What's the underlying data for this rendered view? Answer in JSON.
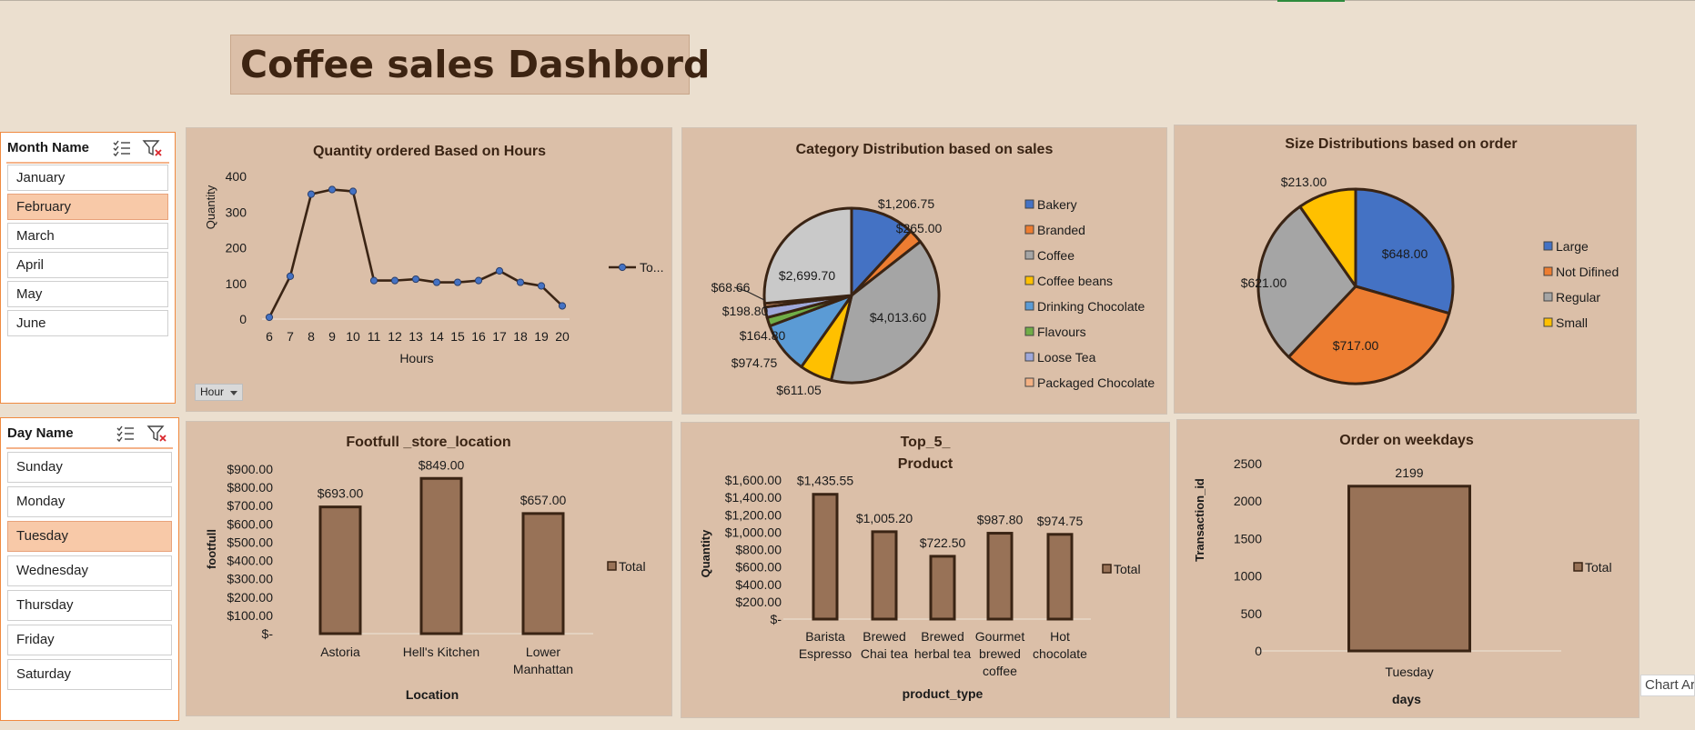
{
  "dashboard": {
    "title": "Coffee sales Dashbord"
  },
  "slicers": {
    "month": {
      "title": "Month Name",
      "items": [
        {
          "label": "January",
          "selected": false
        },
        {
          "label": "February",
          "selected": true
        },
        {
          "label": "March",
          "selected": false
        },
        {
          "label": "April",
          "selected": false
        },
        {
          "label": "May",
          "selected": false
        },
        {
          "label": "June",
          "selected": false
        }
      ]
    },
    "day": {
      "title": "Day Name",
      "items": [
        {
          "label": "Sunday",
          "selected": false
        },
        {
          "label": "Monday",
          "selected": false
        },
        {
          "label": "Tuesday",
          "selected": true
        },
        {
          "label": "Wednesday",
          "selected": false
        },
        {
          "label": "Thursday",
          "selected": false
        },
        {
          "label": "Friday",
          "selected": false
        },
        {
          "label": "Saturday",
          "selected": false
        }
      ]
    }
  },
  "hour_filter": {
    "label": "Hour"
  },
  "tooltip": {
    "text": "Chart Area"
  },
  "colors": {
    "panel": "#dbbfa8",
    "bar": "#987257",
    "dark": "#3a2414",
    "marker": "#4472c4"
  },
  "chart_data": [
    {
      "id": "hours",
      "type": "line",
      "title": "Quantity  ordered Based on Hours",
      "xlabel": "Hours",
      "ylabel": "Quantity",
      "x": [
        6,
        7,
        8,
        9,
        10,
        11,
        12,
        13,
        14,
        15,
        16,
        17,
        18,
        19,
        20
      ],
      "series": [
        {
          "name": "To...",
          "values": [
            5,
            120,
            350,
            363,
            358,
            108,
            108,
            112,
            103,
            103,
            108,
            135,
            103,
            93,
            37
          ]
        }
      ],
      "yticks": [
        "400",
        "300",
        "200",
        "100",
        "0"
      ],
      "ylim": [
        0,
        400
      ],
      "legend": "right"
    },
    {
      "id": "category",
      "type": "pie",
      "title": "Category Distribution based on sales",
      "labels": [
        "Bakery",
        "Branded",
        "Coffee",
        "Coffee beans",
        "Drinking Chocolate",
        "Flavours",
        "Loose Tea",
        "Packaged Chocolate"
      ],
      "data_labels": [
        "$1,206.75",
        "$265.00",
        "$4,013.60",
        "$611.05",
        "$974.75",
        "$164.80",
        "$198.80",
        "$68.66",
        "$2,699.70"
      ],
      "slices": [
        {
          "label": "Bakery",
          "value": 1206.75,
          "color": "#4472c4"
        },
        {
          "label": "Branded",
          "value": 265.0,
          "color": "#ed7d31"
        },
        {
          "label": "Coffee",
          "value": 4013.6,
          "color": "#a5a5a5"
        },
        {
          "label": "Coffee beans",
          "value": 611.05,
          "color": "#ffc000"
        },
        {
          "label": "Drinking Chocolate",
          "value": 974.75,
          "color": "#5b9bd5"
        },
        {
          "label": "Flavours",
          "value": 164.8,
          "color": "#70ad47"
        },
        {
          "label": "Loose Tea",
          "value": 198.8,
          "color": "#9fa8da"
        },
        {
          "label": "Packaged Chocolate",
          "value": 68.66,
          "color": "#f4b183"
        },
        {
          "label": "",
          "value": 2699.7,
          "color": "#c9c9c9"
        }
      ],
      "legend": "right"
    },
    {
      "id": "size",
      "type": "pie",
      "title": "Size Distributions based on order",
      "labels": [
        "Large",
        "Not Difined",
        "Regular",
        "Small"
      ],
      "data_labels": [
        "$648.00",
        "$717.00",
        "$621.00",
        "$213.00"
      ],
      "slices": [
        {
          "label": "Large",
          "value": 648,
          "color": "#4472c4"
        },
        {
          "label": "Not Difined",
          "value": 717,
          "color": "#ed7d31"
        },
        {
          "label": "Regular",
          "value": 621,
          "color": "#a5a5a5"
        },
        {
          "label": "Small",
          "value": 213,
          "color": "#ffc000"
        }
      ],
      "legend": "right"
    },
    {
      "id": "footfall",
      "type": "bar",
      "title": "Footfull _store_location",
      "xlabel": "Location",
      "ylabel": "footfull",
      "categories": [
        "Astoria",
        "Hell's Kitchen",
        "Lower Manhattan"
      ],
      "values": [
        693,
        849,
        657
      ],
      "data_labels": [
        "$693.00",
        "$849.00",
        "$657.00"
      ],
      "yticks": [
        "$900.00",
        "$800.00",
        "$700.00",
        "$600.00",
        "$500.00",
        "$400.00",
        "$300.00",
        "$200.00",
        "$100.00",
        "$-"
      ],
      "ylim": [
        0,
        900
      ],
      "series": [
        {
          "name": "Total"
        }
      ],
      "legend": "right"
    },
    {
      "id": "top5",
      "type": "bar",
      "title": "Top_5_ Product",
      "title_lines": [
        "Top_5_",
        "Product"
      ],
      "xlabel": "product_type",
      "ylabel": "Quantity",
      "categories": [
        "Barista Espresso",
        "Brewed Chai tea",
        "Brewed herbal tea",
        "Gourmet brewed coffee",
        "Hot chocolate"
      ],
      "category_lines": [
        [
          "Barista",
          "Espresso"
        ],
        [
          "Brewed",
          "Chai tea"
        ],
        [
          "Brewed",
          "herbal tea"
        ],
        [
          "Gourmet",
          "brewed",
          "coffee"
        ],
        [
          "Hot",
          "chocolate"
        ]
      ],
      "values": [
        1435.55,
        1005.2,
        722.5,
        987.8,
        974.75
      ],
      "data_labels": [
        "$1,435.55",
        "$1,005.20",
        "$722.50",
        "$987.80",
        "$974.75"
      ],
      "yticks": [
        "$1,600.00",
        "$1,400.00",
        "$1,200.00",
        "$1,000.00",
        "$800.00",
        "$600.00",
        "$400.00",
        "$200.00",
        "$-"
      ],
      "ylim": [
        0,
        1600
      ],
      "series": [
        {
          "name": "Total"
        }
      ],
      "legend": "right"
    },
    {
      "id": "weekdays",
      "type": "bar",
      "title": "Order on weekdays",
      "xlabel": "days",
      "ylabel": "Transaction_id",
      "categories": [
        "Tuesday"
      ],
      "values": [
        2199
      ],
      "data_labels": [
        "2199"
      ],
      "yticks": [
        "2500",
        "2000",
        "1500",
        "1000",
        "500",
        "0"
      ],
      "ylim": [
        0,
        2500
      ],
      "series": [
        {
          "name": "Total"
        }
      ],
      "legend": "right"
    }
  ]
}
